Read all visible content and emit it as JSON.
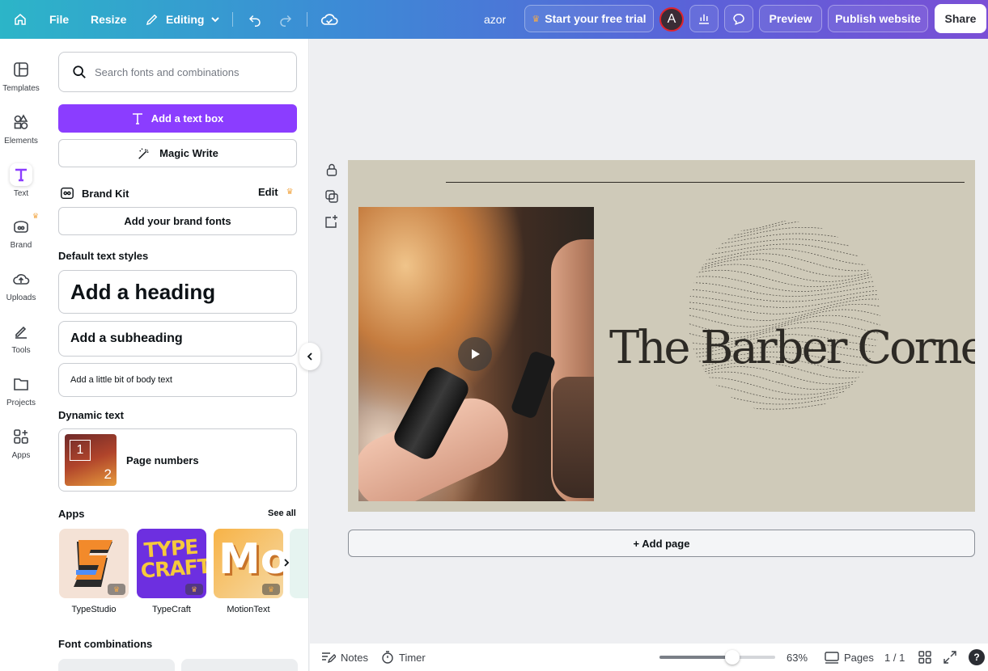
{
  "topbar": {
    "file": "File",
    "resize": "Resize",
    "editing": "Editing",
    "doc_title": "azor",
    "trial": "Start your free trial",
    "avatar_initial": "A",
    "preview": "Preview",
    "publish": "Publish website",
    "share": "Share"
  },
  "rail": [
    {
      "label": "Templates",
      "icon": "templates-icon"
    },
    {
      "label": "Elements",
      "icon": "elements-icon"
    },
    {
      "label": "Text",
      "icon": "text-icon"
    },
    {
      "label": "Brand",
      "icon": "brand-icon"
    },
    {
      "label": "Uploads",
      "icon": "uploads-icon"
    },
    {
      "label": "Tools",
      "icon": "tools-icon"
    },
    {
      "label": "Projects",
      "icon": "projects-icon"
    },
    {
      "label": "Apps",
      "icon": "apps-icon"
    }
  ],
  "panel": {
    "search_placeholder": "Search fonts and combinations",
    "add_text_box": "Add a text box",
    "magic_write": "Magic Write",
    "brand_kit": "Brand Kit",
    "brand_edit": "Edit",
    "add_brand_fonts": "Add your brand fonts",
    "default_styles": "Default text styles",
    "heading": "Add a heading",
    "subheading": "Add a subheading",
    "body": "Add a little bit of body text",
    "dynamic_text": "Dynamic text",
    "page_numbers": "Page numbers",
    "apps_title": "Apps",
    "see_all": "See all",
    "apps": [
      "TypeStudio",
      "TypeCraft",
      "MotionText"
    ],
    "font_combinations": "Font combinations"
  },
  "canvas": {
    "headline": "The Barber Corner",
    "add_page": "+ Add page",
    "page_bg": "#cfcab9"
  },
  "bottom": {
    "notes": "Notes",
    "timer": "Timer",
    "zoom": "63%",
    "zoom_level": 0.63,
    "pages": "Pages",
    "page_count": "1 / 1"
  },
  "colors": {
    "accent": "#8b3dff",
    "crown": "#f2a94a"
  }
}
